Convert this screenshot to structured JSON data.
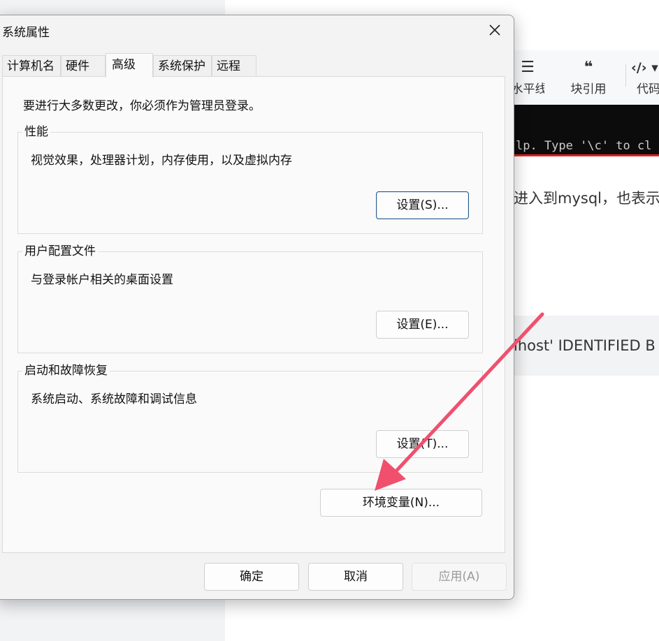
{
  "background": {
    "toolbar": [
      {
        "icon": "☰",
        "label": "水平线"
      },
      {
        "icon": "❝",
        "label": "块引用"
      },
      {
        "icon": "‹/› ▾",
        "label": "代码"
      }
    ],
    "console_text": "lp. Type '\\c' to cl",
    "text_line": "进入到mysql，也表示",
    "code_line": "lhost' IDENTIFIED B"
  },
  "dialog": {
    "title": "系统属性",
    "tabs": [
      {
        "label": "计算机名"
      },
      {
        "label": "硬件"
      },
      {
        "label": "高级",
        "active": true
      },
      {
        "label": "系统保护"
      },
      {
        "label": "远程"
      }
    ],
    "notice": "要进行大多数更改，你必须作为管理员登录。",
    "groups": [
      {
        "title": "性能",
        "description": "视觉效果，处理器计划，内存使用，以及虚拟内存",
        "button": "设置(S)..."
      },
      {
        "title": "用户配置文件",
        "description": "与登录帐户相关的桌面设置",
        "button": "设置(E)..."
      },
      {
        "title": "启动和故障恢复",
        "description": "系统启动、系统故障和调试信息",
        "button": "设置(T)..."
      }
    ],
    "env_button": "环境变量(N)...",
    "footer": {
      "ok": "确定",
      "cancel": "取消",
      "apply": "应用(A)"
    }
  },
  "annotation": {
    "arrow_color": "#f0506e"
  }
}
